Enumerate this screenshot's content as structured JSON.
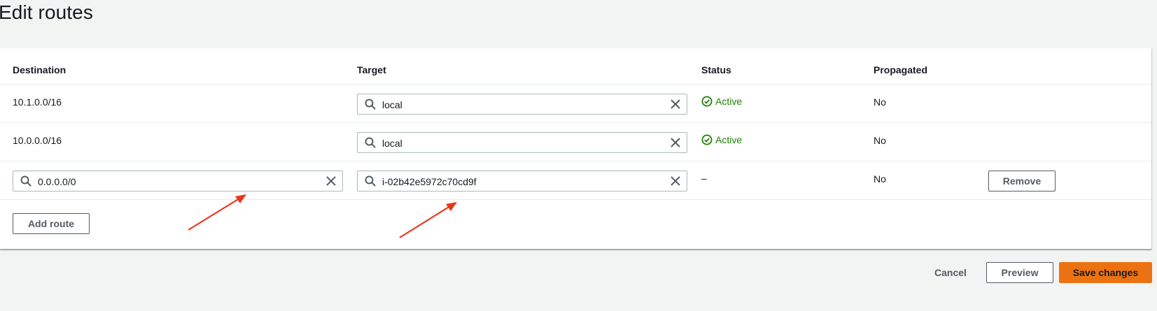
{
  "page": {
    "title": "Edit routes"
  },
  "table": {
    "headers": {
      "destination": "Destination",
      "target": "Target",
      "status": "Status",
      "propagated": "Propagated"
    },
    "rows": [
      {
        "destination": "10.1.0.0/16",
        "target": "local",
        "status": "Active",
        "propagated": "No"
      },
      {
        "destination": "10.0.0.0/16",
        "target": "local",
        "status": "Active",
        "propagated": "No"
      },
      {
        "destination": "0.0.0.0/0",
        "target": "i-02b42e5972c70cd9f",
        "status": "–",
        "propagated": "No",
        "remove_label": "Remove"
      }
    ]
  },
  "actions": {
    "add_route": "Add route",
    "cancel": "Cancel",
    "preview": "Preview",
    "save": "Save changes"
  },
  "colors": {
    "active": "#1d8102",
    "primary": "#ec7211",
    "annotation_arrow": "#e8351b"
  }
}
